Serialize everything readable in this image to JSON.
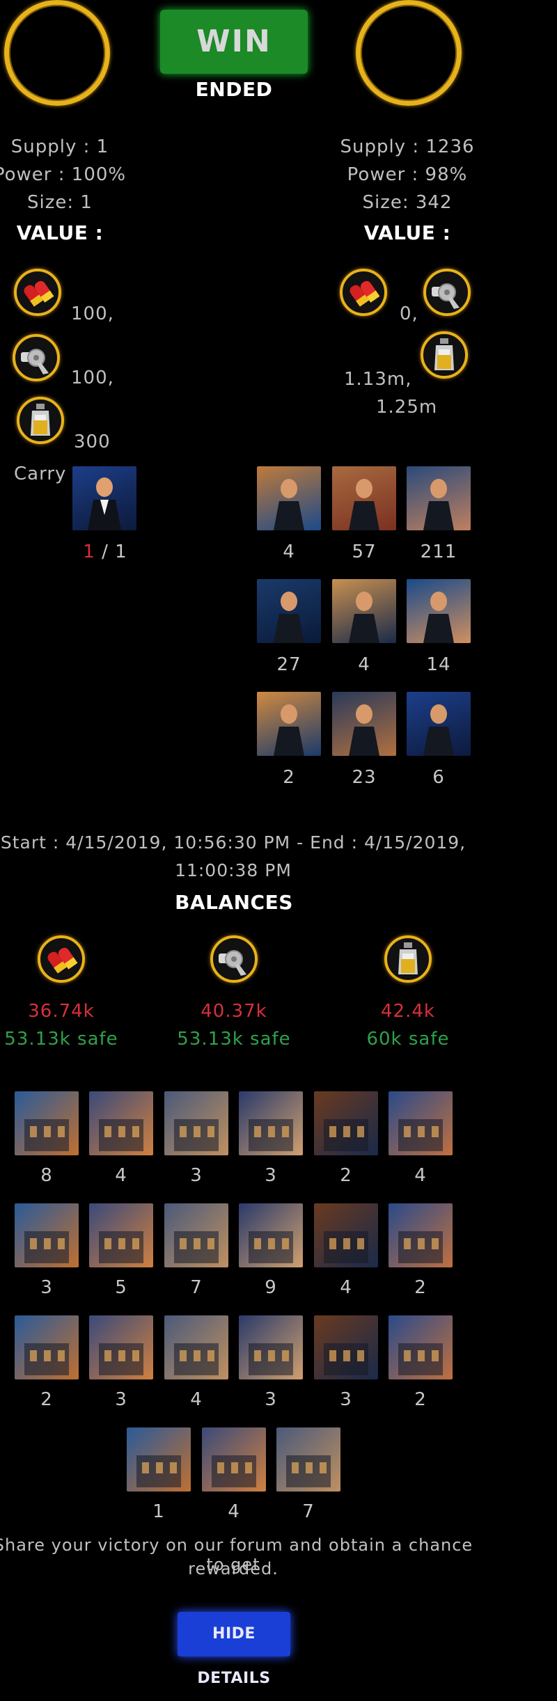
{
  "header": {
    "result_label": "WIN",
    "status_label": "ENDED"
  },
  "left": {
    "supply": "Supply : 1",
    "power": "Power : 100%",
    "size": "Size: 1",
    "value_label": "VALUE :",
    "values": [
      "100,",
      "100,",
      "300"
    ],
    "carry_label": "Carry",
    "carry_current": "1",
    "carry_sep": " / ",
    "carry_total": "1"
  },
  "right": {
    "supply": "Supply : 1236",
    "power": "Power : 98%",
    "size": "Size: 342",
    "value_label": "VALUE :",
    "values": [
      "0,",
      "1.13m,",
      "1.25m"
    ],
    "unit_counts": [
      "4",
      "57",
      "211",
      "27",
      "4",
      "14",
      "2",
      "23",
      "6"
    ]
  },
  "times": {
    "line1": "Start : 4/15/2019, 10:56:30 PM - End : 4/15/2019,",
    "line2": "11:00:38 PM"
  },
  "balances": {
    "title": "BALANCES",
    "items": [
      {
        "value": "36.74k",
        "safe": "53.13k safe"
      },
      {
        "value": "40.37k",
        "safe": "53.13k safe"
      },
      {
        "value": "42.4k",
        "safe": "60k safe"
      }
    ]
  },
  "buildings": {
    "counts": [
      "8",
      "4",
      "3",
      "3",
      "2",
      "4",
      "3",
      "5",
      "7",
      "9",
      "4",
      "2",
      "2",
      "3",
      "4",
      "3",
      "3",
      "2",
      "1",
      "4",
      "7"
    ]
  },
  "footer": {
    "share_line1": "Share your victory on our forum and obtain a chance to get",
    "share_line2": "rewarded.",
    "hide_label": "HIDE DETAILS"
  },
  "icons": {
    "ammo": "ammo-icon",
    "weapon": "revolver-icon",
    "alcohol": "bottle-icon"
  },
  "colors": {
    "gold": "#e8b21a",
    "win_green": "#1b8a27",
    "loss_red": "#d8303a",
    "safe_green": "#2fa14a",
    "button_blue": "#1a3fd6"
  }
}
